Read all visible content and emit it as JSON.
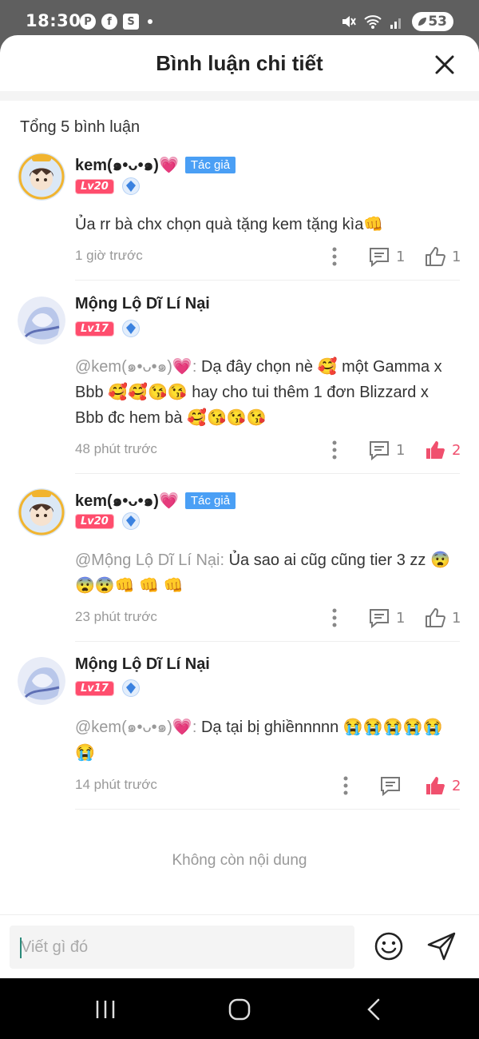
{
  "status_bar": {
    "time": "18:30",
    "battery": "53"
  },
  "header": {
    "title": "Bình luận chi tiết"
  },
  "total_label": "Tổng 5 bình luận",
  "comments": [
    {
      "username": "kem(๑•ᴗ•๑)💗",
      "author_badge": "Tác giả",
      "level": "Lv20",
      "mention": "",
      "text": "Ủa rr bà chx chọn quà tặng kem tặng kìa👊",
      "time": "1 giờ trước",
      "reply_count": "1",
      "like_count": "1",
      "liked": false
    },
    {
      "username": "Mộng Lộ Dĩ Lí Nại",
      "author_badge": "",
      "level": "Lv17",
      "mention": "@kem(๑•ᴗ•๑)💗: ",
      "text": "Dạ đây chọn nè 🥰 một Gamma x Bbb 🥰🥰😘😘 hay cho tui thêm 1 đơn Blizzard x Bbb đc hem bà 🥰😘😘😘",
      "time": "48 phút trước",
      "reply_count": "1",
      "like_count": "2",
      "liked": true
    },
    {
      "username": "kem(๑•ᴗ•๑)💗",
      "author_badge": "Tác giả",
      "level": "Lv20",
      "mention": "@Mộng Lộ Dĩ Lí Nại: ",
      "text": "Ủa sao ai cũg cũng tier 3 zz 😨😨😨👊 👊 👊",
      "time": "23 phút trước",
      "reply_count": "1",
      "like_count": "1",
      "liked": false
    },
    {
      "username": "Mộng Lộ Dĩ Lí Nại",
      "author_badge": "",
      "level": "Lv17",
      "mention": "@kem(๑•ᴗ•๑)💗: ",
      "text": "Dạ tại bị ghiềnnnnn 😭😭😭😭😭😭",
      "time": "14 phút trước",
      "reply_count": "",
      "like_count": "2",
      "liked": true
    }
  ],
  "end_text": "Không còn nội dung",
  "input": {
    "placeholder": "Viết gì đó"
  },
  "colors": {
    "accent_like": "#f0506e",
    "author_badge": "#4a9ff5",
    "level_badge": "#ff4d6d"
  }
}
